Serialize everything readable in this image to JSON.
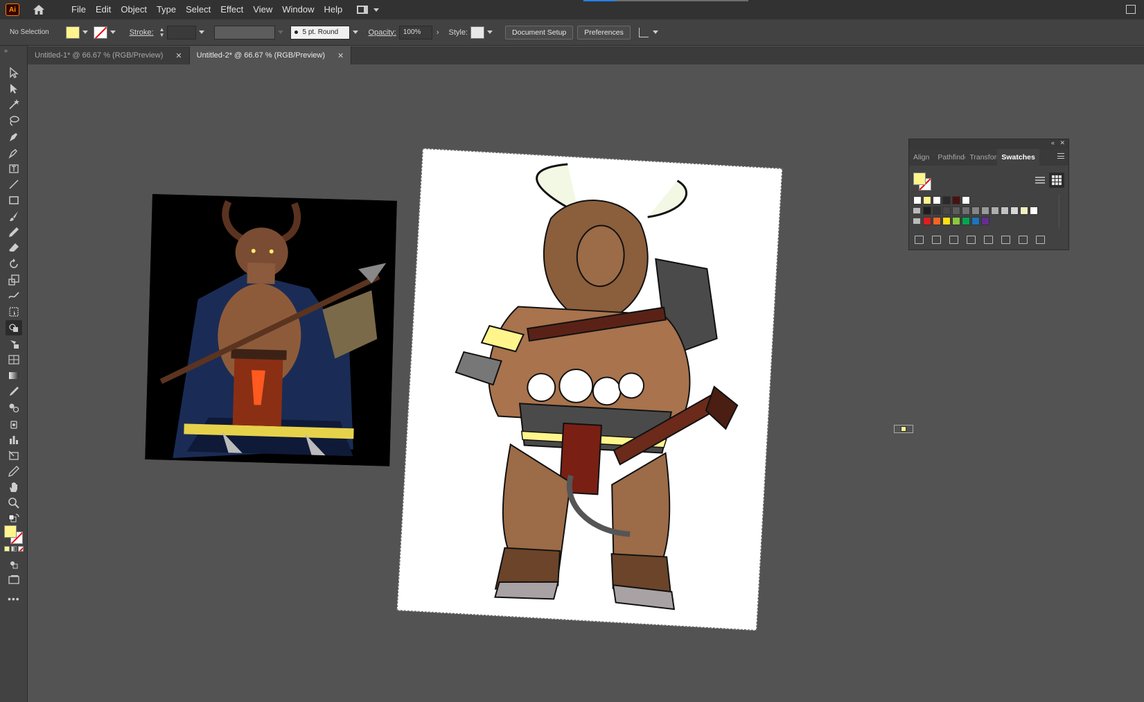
{
  "app": {
    "logo": "Ai"
  },
  "menu": [
    "File",
    "Edit",
    "Object",
    "Type",
    "Select",
    "Effect",
    "View",
    "Window",
    "Help"
  ],
  "control_bar": {
    "selection": "No Selection",
    "stroke_label": "Stroke:",
    "brush": "5 pt. Round",
    "opacity_label": "Opacity:",
    "opacity_value": "100%",
    "style_label": "Style:",
    "document_setup": "Document Setup",
    "preferences": "Preferences",
    "fill_color": "#fff58c"
  },
  "tabs": [
    {
      "label": "Untitled-1* @ 66.67 % (RGB/Preview)",
      "active": false
    },
    {
      "label": "Untitled-2* @ 66.67 % (RGB/Preview)",
      "active": true
    }
  ],
  "tools": [
    "selection-tool",
    "direct-selection-tool",
    "magic-wand-tool",
    "lasso-tool",
    "pen-tool",
    "curvature-tool",
    "artboard-text-tool",
    "line-segment-tool",
    "rectangle-tool",
    "paintbrush-tool",
    "pencil-tool",
    "eraser-tool",
    "rotate-tool",
    "scale-tool",
    "warp-tool",
    "free-transform-tool",
    "shape-builder-tool",
    "live-paint-tool",
    "perspective-grid-tool",
    "gradient-tool",
    "eyedropper-tool",
    "blend-tool",
    "symbol-sprayer-tool",
    "column-graph-tool",
    "slice-tool",
    "eyedropper-alt-tool",
    "hand-tool",
    "zoom-tool"
  ],
  "swatches_panel": {
    "tabs": [
      "Align",
      "Pathfinder",
      "Transform",
      "Swatches"
    ],
    "active_tab": "Swatches",
    "fill_color": "#fff58c",
    "row1": [
      "#ffffff",
      "#fff58c",
      "#ffffff",
      "#2a2a2a",
      "#4a1010",
      "#ffffff"
    ],
    "row2": [
      "#1e1e1e",
      "#333333",
      "#474747",
      "#5c5c5c",
      "#707070",
      "#858585",
      "#999999",
      "#adadad",
      "#c2c2c2",
      "#d6d6d6",
      "#f0f0c0",
      "#ffffff"
    ],
    "row3": [
      "#e01e1e",
      "#f26522",
      "#ffde17",
      "#8dc63f",
      "#00a651",
      "#1c75bc",
      "#662d91"
    ]
  }
}
